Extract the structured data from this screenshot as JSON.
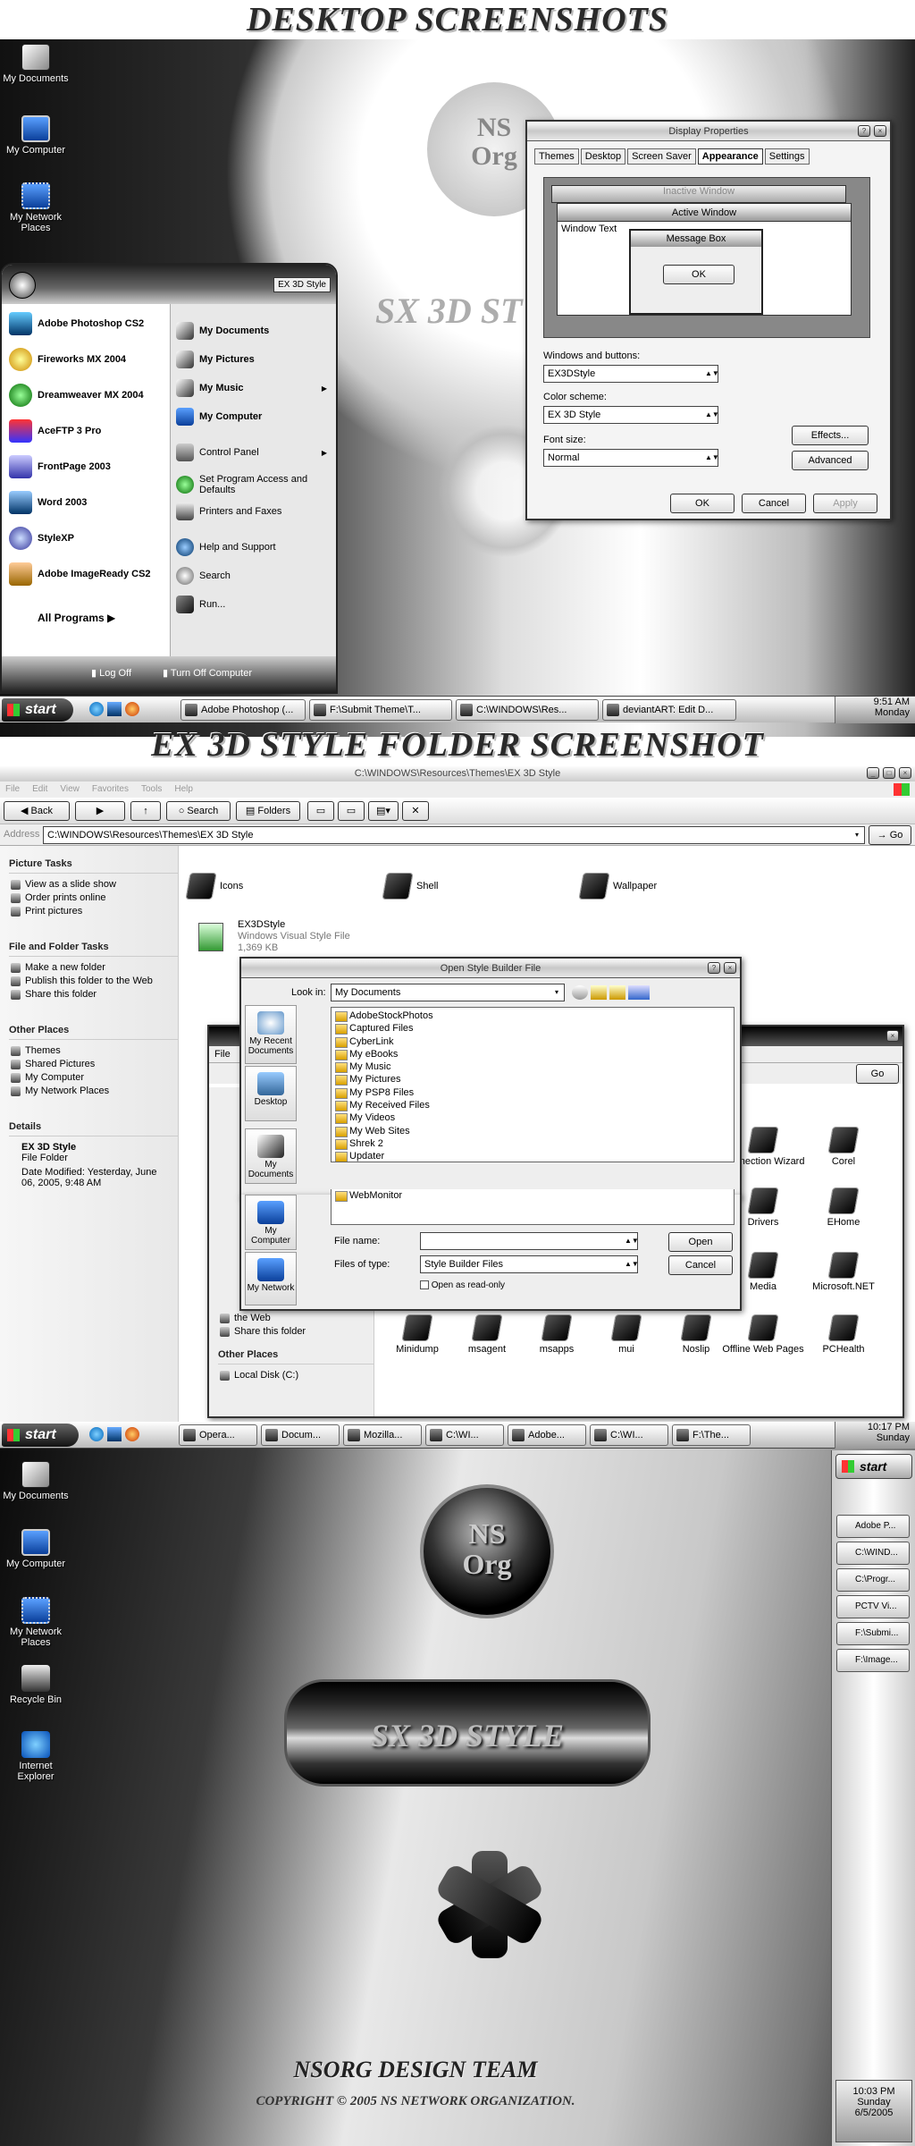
{
  "headers": {
    "desktop": "DESKTOP SCREENSHOTS",
    "folder": "EX 3D STYLE FOLDER SCREENSHOT",
    "team": "NSORG DESIGN TEAM",
    "copyright": "COPYRIGHT © 2005 NS NETWORK ORGANIZATION."
  },
  "logo": {
    "ns": "NS",
    "org": "Org",
    "style": "SX 3D STYLE",
    "sx_short": "SX 3D ST"
  },
  "desktop1": {
    "icons": [
      "My Documents",
      "My Computer",
      "My Network Places"
    ],
    "display_props": {
      "title": "Display Properties",
      "tabs": [
        "Themes",
        "Desktop",
        "Screen Saver",
        "Appearance",
        "Settings"
      ],
      "preview": {
        "inactive": "Inactive Window",
        "active": "Active Window",
        "window_text": "Window Text",
        "msgbox": "Message Box",
        "ok": "OK"
      },
      "windows_buttons_label": "Windows and buttons:",
      "windows_buttons_value": "EX3DStyle",
      "color_scheme_label": "Color scheme:",
      "color_scheme_value": "EX 3D Style",
      "font_size_label": "Font size:",
      "font_size_value": "Normal",
      "effects": "Effects...",
      "advanced": "Advanced",
      "ok": "OK",
      "cancel": "Cancel",
      "apply": "Apply"
    },
    "start_menu": {
      "badge": "EX 3D Style",
      "left": [
        "Adobe Photoshop CS2",
        "Fireworks MX 2004",
        "Dreamweaver MX 2004",
        "AceFTP 3 Pro",
        "FrontPage 2003",
        "Word 2003",
        "StyleXP",
        "Adobe ImageReady CS2"
      ],
      "all_programs": "All Programs",
      "right": [
        "My Documents",
        "My Pictures",
        "My Music",
        "My Computer",
        "Control Panel",
        "Set Program Access and Defaults",
        "Printers and Faxes",
        "Help and Support",
        "Search",
        "Run..."
      ],
      "logoff": "Log Off",
      "turnoff": "Turn Off Computer"
    },
    "taskbar": {
      "start": "start",
      "tasks": [
        "Adobe Photoshop (...",
        "F:\\Submit Theme\\T...",
        "C:\\WINDOWS\\Res...",
        "deviantART: Edit D..."
      ],
      "time": "9:51 AM",
      "day": "Monday"
    }
  },
  "explorer": {
    "title": "C:\\WINDOWS\\Resources\\Themes\\EX 3D Style",
    "menu": [
      "File",
      "Edit",
      "View",
      "Favorites",
      "Tools",
      "Help"
    ],
    "toolbar": {
      "back": "Back",
      "search": "Search",
      "folders": "Folders"
    },
    "address_label": "Address",
    "address": "C:\\WINDOWS\\Resources\\Themes\\EX 3D Style",
    "go": "Go",
    "picture_tasks": {
      "title": "Picture Tasks",
      "items": [
        "View as a slide show",
        "Order prints online",
        "Print pictures"
      ]
    },
    "file_tasks": {
      "title": "File and Folder Tasks",
      "items": [
        "Make a new folder",
        "Publish this folder to the Web",
        "Share this folder"
      ]
    },
    "other_places": {
      "title": "Other Places",
      "items": [
        "Themes",
        "Shared Pictures",
        "My Computer",
        "My Network Places"
      ]
    },
    "details": {
      "title": "Details",
      "name": "EX 3D Style",
      "type": "File Folder",
      "modified": "Date Modified: Yesterday, June 06, 2005, 9:48 AM"
    },
    "folders": [
      "Icons",
      "Shell",
      "Wallpaper"
    ],
    "file": {
      "name": "EX3DStyle",
      "type": "Windows Visual Style File",
      "size": "1,369 KB"
    },
    "dialog": {
      "title": "Open Style Builder File",
      "lookin_label": "Look in:",
      "lookin": "My Documents",
      "places": [
        "My Recent Documents",
        "Desktop",
        "My Documents",
        "My Computer",
        "My Network"
      ],
      "files": [
        "AdobeStockPhotos",
        "Captured Files",
        "CyberLink",
        "My eBooks",
        "My Music",
        "My Pictures",
        "My PSP8 Files",
        "My Received Files",
        "My Videos",
        "My Web Sites",
        "Shrek 2",
        "Updater",
        "WebMonitor"
      ],
      "filename_label": "File name:",
      "filetype_label": "Files of type:",
      "filetype": "Style Builder Files",
      "readonly": "Open as read-only",
      "open": "Open",
      "cancel": "Cancel"
    },
    "back_window": {
      "file": "File",
      "go": "Go",
      "tasks_partial": [
        "the Web",
        "Share this folder"
      ],
      "other_places": "Other Places",
      "local_disk": "Local Disk (C:)",
      "icons": [
        "Connection Wizard",
        "Corel",
        "Drivers",
        "EHome",
        "Media",
        "Microsoft.NET",
        "Minidump",
        "msagent",
        "msapps",
        "mui",
        "Noslip",
        "Offline Web Pages",
        "PCHealth"
      ]
    }
  },
  "desktop2": {
    "taskbar": {
      "start": "start",
      "tasks": [
        "Opera...",
        "Docum...",
        "Mozilla...",
        "C:\\WI...",
        "Adobe...",
        "C:\\WI...",
        "F:\\The..."
      ],
      "time": "10:17 PM",
      "day": "Sunday"
    },
    "icons": [
      "My Documents",
      "My Computer",
      "My Network Places",
      "Recycle Bin",
      "Internet Explorer"
    ],
    "sidebar": {
      "start": "start",
      "tasks": [
        "Adobe P...",
        "C:\\WIND...",
        "C:\\Progr...",
        "PCTV Vi...",
        "F:\\Submi...",
        "F:\\Image..."
      ],
      "time": "10:03 PM",
      "day": "Sunday",
      "date": "6/5/2005"
    }
  }
}
